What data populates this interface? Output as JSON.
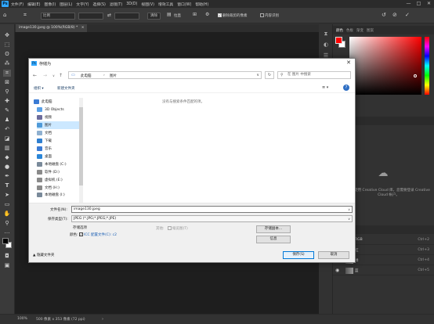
{
  "app": {
    "logo": "Ps"
  },
  "menubar": {
    "items": [
      "文件(F)",
      "编辑(E)",
      "图像(I)",
      "图层(L)",
      "文字(Y)",
      "选择(S)",
      "滤镜(T)",
      "3D(D)",
      "视图(V)",
      "增效工具",
      "窗口(W)",
      "帮助(H)"
    ],
    "window_controls": [
      "—",
      "□",
      "✕"
    ]
  },
  "options_bar": {
    "style_value": "比例",
    "swap_icon": "⇄",
    "clear_label": "清除",
    "straighten_label": "拉直",
    "grid_icon": "⊞",
    "gear_icon": "⚙",
    "delete_cropped_label": "删除裁剪的像素",
    "content_aware_label": "内容识别",
    "reset_icon": "↺",
    "cancel_icon": "⊘",
    "commit_icon": "✓"
  },
  "document": {
    "tab_title": "image130.jpeg @ 100%(RGB/8) *",
    "tab_close": "×"
  },
  "status": {
    "zoom": "100%",
    "info": "500 像素 x 353 像素 (72 ppi)",
    "arrow": "›"
  },
  "panels": {
    "color_tabs": [
      "颜色",
      "色板",
      "渐变",
      "图案"
    ],
    "colors": {
      "foreground": "#ff0000",
      "background": "#ffffff",
      "accent": "#31a8ff"
    },
    "cc_text": "若要使用 Creative Cloud 库，您需要登录 Creative Cloud 帐户。",
    "layer_tabs": [
      "图层",
      "路径"
    ],
    "layers": [
      {
        "name": "RGB",
        "shortcut": "Ctrl+2"
      },
      {
        "name": "红",
        "shortcut": "Ctrl+3"
      },
      {
        "name": "绿",
        "shortcut": "Ctrl+4"
      },
      {
        "name": "蓝",
        "shortcut": "Ctrl+5"
      }
    ]
  },
  "dialog": {
    "title": "存储为",
    "close": "✕",
    "nav_back": "←",
    "nav_forward": "→",
    "nav_down": "∨",
    "nav_up": "↑",
    "address": {
      "seg1": "此电脑",
      "sep": "›",
      "seg2": "图片",
      "drop": "∨"
    },
    "refresh": "↻",
    "search_placeholder": "在 图片 中搜索",
    "organize": "组织 ▾",
    "new_folder": "新建文件夹",
    "view_icon": "≣ ▾",
    "help": "?",
    "empty_message": "没有与搜索条件匹配的项。",
    "nav_items": [
      "此电脑",
      "3D Objects",
      "视频",
      "图片",
      "文档",
      "下载",
      "音乐",
      "桌面",
      "本地磁盘 (C:)",
      "软件 (D:)",
      "虚拟机 (E:)",
      "文档 (H:)",
      "本地磁盘 (I:)"
    ],
    "filename_label": "文件名(N):",
    "filename_value": "image130.jpeg",
    "filetype_label": "保存类型(T):",
    "filetype_value": "JPEG (*.JPG;*.JPEG;*.JPE)",
    "dropdown_arrow": "∨",
    "save_options_label": "存储选项",
    "other_label": "其他:",
    "thumbnail_label": "缩览图(T)",
    "color_label": "颜色:",
    "icc_label": "ICC 配置文件(C):",
    "icc_value": "c2",
    "checkmark": "✓",
    "save_copy_button": "存储副本...",
    "info_button": "信息",
    "hide_folders": "▲ 隐藏文件夹",
    "save_button": "保存(S)",
    "cancel_button": "取消"
  }
}
